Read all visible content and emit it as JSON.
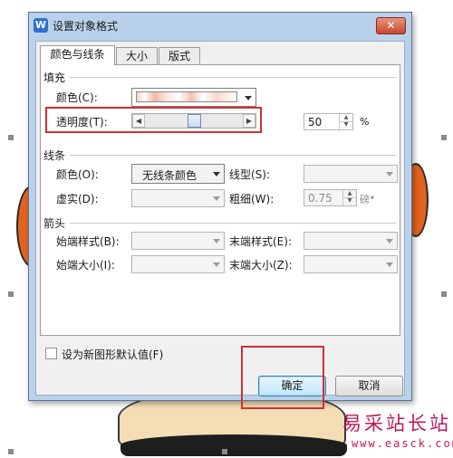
{
  "dialog": {
    "title": "设置对象格式",
    "app_icon_glyph": "W",
    "close_glyph": "✕"
  },
  "tabs": [
    {
      "label": "颜色与线条",
      "active": true
    },
    {
      "label": "大小",
      "active": false
    },
    {
      "label": "版式",
      "active": false
    }
  ],
  "fill": {
    "section_title": "填充",
    "color_label": "颜色(C):",
    "transparency_label": "透明度(T):",
    "transparency_value": "50",
    "transparency_unit": "%",
    "transparency_level": 0.5
  },
  "line": {
    "section_title": "线条",
    "color_label": "颜色(O):",
    "color_value": "无线条颜色",
    "style_label": "线型(S):",
    "dash_label": "虚实(D):",
    "weight_label": "粗细(W):",
    "weight_value": "0.75",
    "weight_unit": "磅"
  },
  "arrows": {
    "section_title": "箭头",
    "begin_style_label": "始端样式(B):",
    "end_style_label": "末端样式(E):",
    "begin_size_label": "始端大小(I):",
    "end_size_label": "末端大小(Z):"
  },
  "default_checkbox_label": "设为新图形默认值(F)",
  "buttons": {
    "ok_label": "确定",
    "cancel_label": "取消"
  },
  "watermark": {
    "site_name": "易采站长站",
    "url": "www.easck.com"
  },
  "colors": {
    "highlight": "#d32f2f",
    "titlebar": "#b9d1ea",
    "watermark": "#c2185b"
  }
}
